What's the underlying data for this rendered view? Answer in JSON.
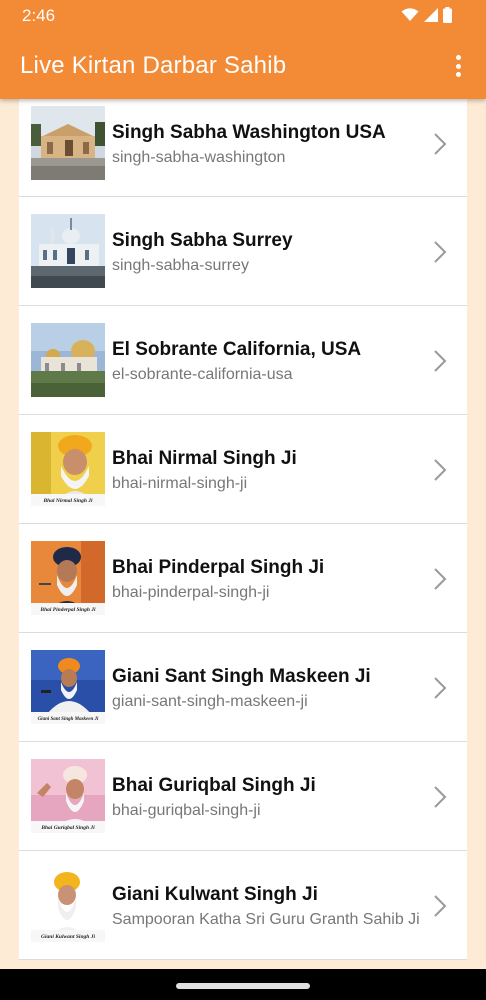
{
  "status_bar": {
    "time": "2:46"
  },
  "app_bar": {
    "title": "Live Kirtan Darbar Sahib",
    "overflow_icon": "more-vert-icon"
  },
  "list": {
    "items": [
      {
        "title": "Singh Sabha Washington USA",
        "subtitle": "singh-sabha-washington"
      },
      {
        "title": "Singh Sabha Surrey",
        "subtitle": "singh-sabha-surrey"
      },
      {
        "title": "El Sobrante California, USA",
        "subtitle": "el-sobrante-california-usa"
      },
      {
        "title": "Bhai Nirmal Singh Ji",
        "subtitle": "bhai-nirmal-singh-ji",
        "thumb_caption": "Bhai Nirmal Singh Ji"
      },
      {
        "title": "Bhai Pinderpal Singh Ji",
        "subtitle": "bhai-pinderpal-singh-ji",
        "thumb_caption": "Bhai Pinderpal Singh Ji"
      },
      {
        "title": "Giani Sant Singh Maskeen Ji",
        "subtitle": "giani-sant-singh-maskeen-ji",
        "thumb_caption": "Giani Sant Singh Maskeen Ji"
      },
      {
        "title": "Bhai Guriqbal Singh Ji",
        "subtitle": "bhai-guriqbal-singh-ji",
        "thumb_caption": "Bhai Guriqbal Singh Ji"
      },
      {
        "title": "Giani Kulwant Singh Ji",
        "subtitle": "Sampooran Katha Sri Guru Granth Sahib Ji",
        "thumb_caption": "Giani Kulwant Singh Ji"
      }
    ]
  },
  "colors": {
    "app_bar": "#f28a36",
    "background": "#fdebd6",
    "title_text": "#111111",
    "subtitle_text": "#777777"
  }
}
